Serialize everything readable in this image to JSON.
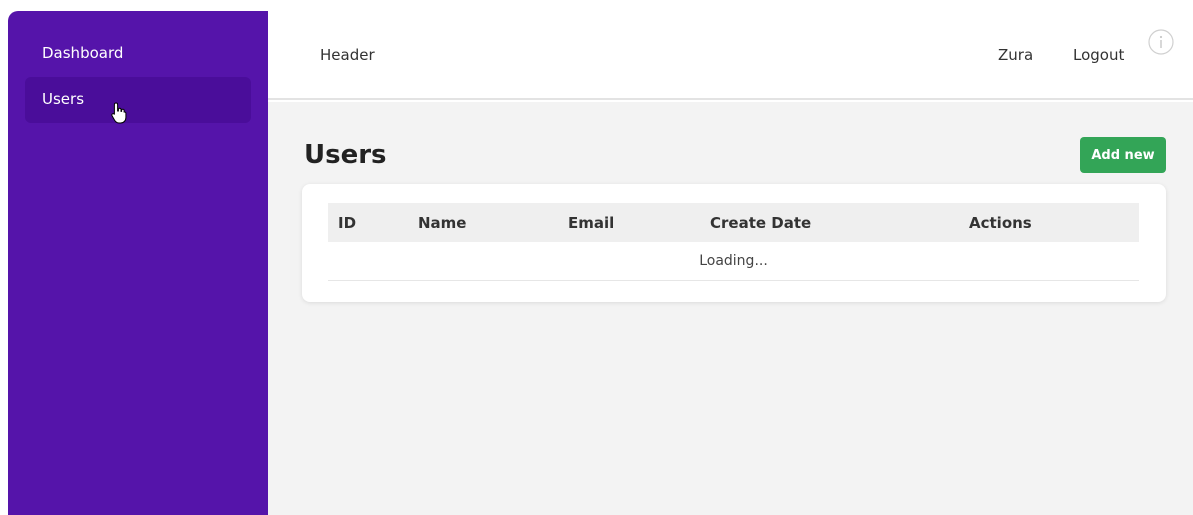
{
  "sidebar": {
    "items": [
      {
        "label": "Dashboard"
      },
      {
        "label": "Users"
      }
    ]
  },
  "header": {
    "title": "Header",
    "user": "Zura",
    "logout_label": "Logout"
  },
  "main": {
    "page_title": "Users",
    "add_button_label": "Add new",
    "table": {
      "columns": [
        "ID",
        "Name",
        "Email",
        "Create Date",
        "Actions"
      ],
      "loading_text": "Loading..."
    }
  },
  "colors": {
    "sidebar_bg": "#5514aa",
    "sidebar_active": "#4a0d9a",
    "add_button": "#33a557",
    "main_bg": "#f3f3f3"
  }
}
